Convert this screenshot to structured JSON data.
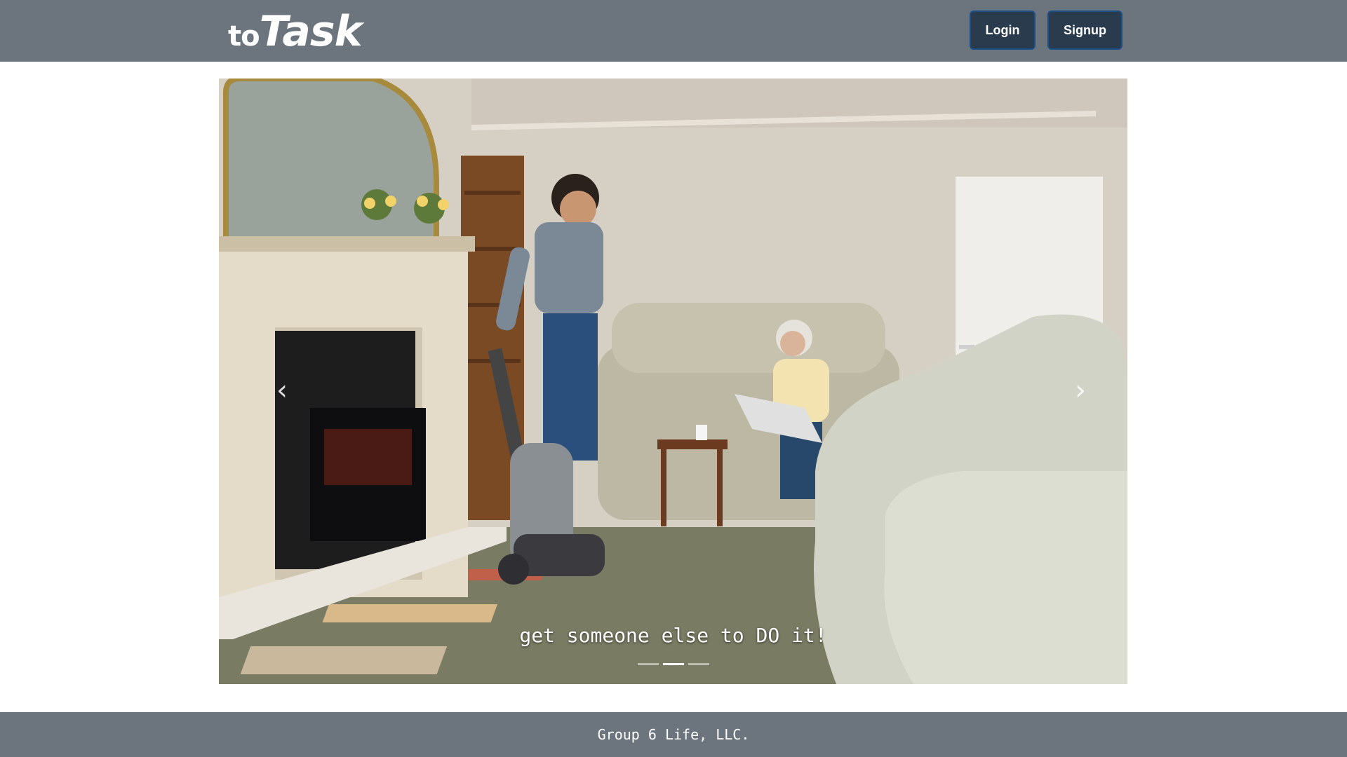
{
  "brand": {
    "prefix": "to",
    "name": "Task"
  },
  "nav": {
    "login_label": "Login",
    "signup_label": "Signup"
  },
  "carousel": {
    "caption": "get someone else to DO it!",
    "prev_glyph": "‹",
    "next_glyph": "›",
    "slide_count": 3,
    "active_slide": 2,
    "image_description": "living room photo: young man vacuuming, elderly woman reading a newspaper on a sofa"
  },
  "footer": {
    "text": "Group 6 Life, LLC."
  },
  "colors": {
    "navbar": "#6c757d",
    "button": "#2b3b4e",
    "button_border": "#1a4e86"
  }
}
